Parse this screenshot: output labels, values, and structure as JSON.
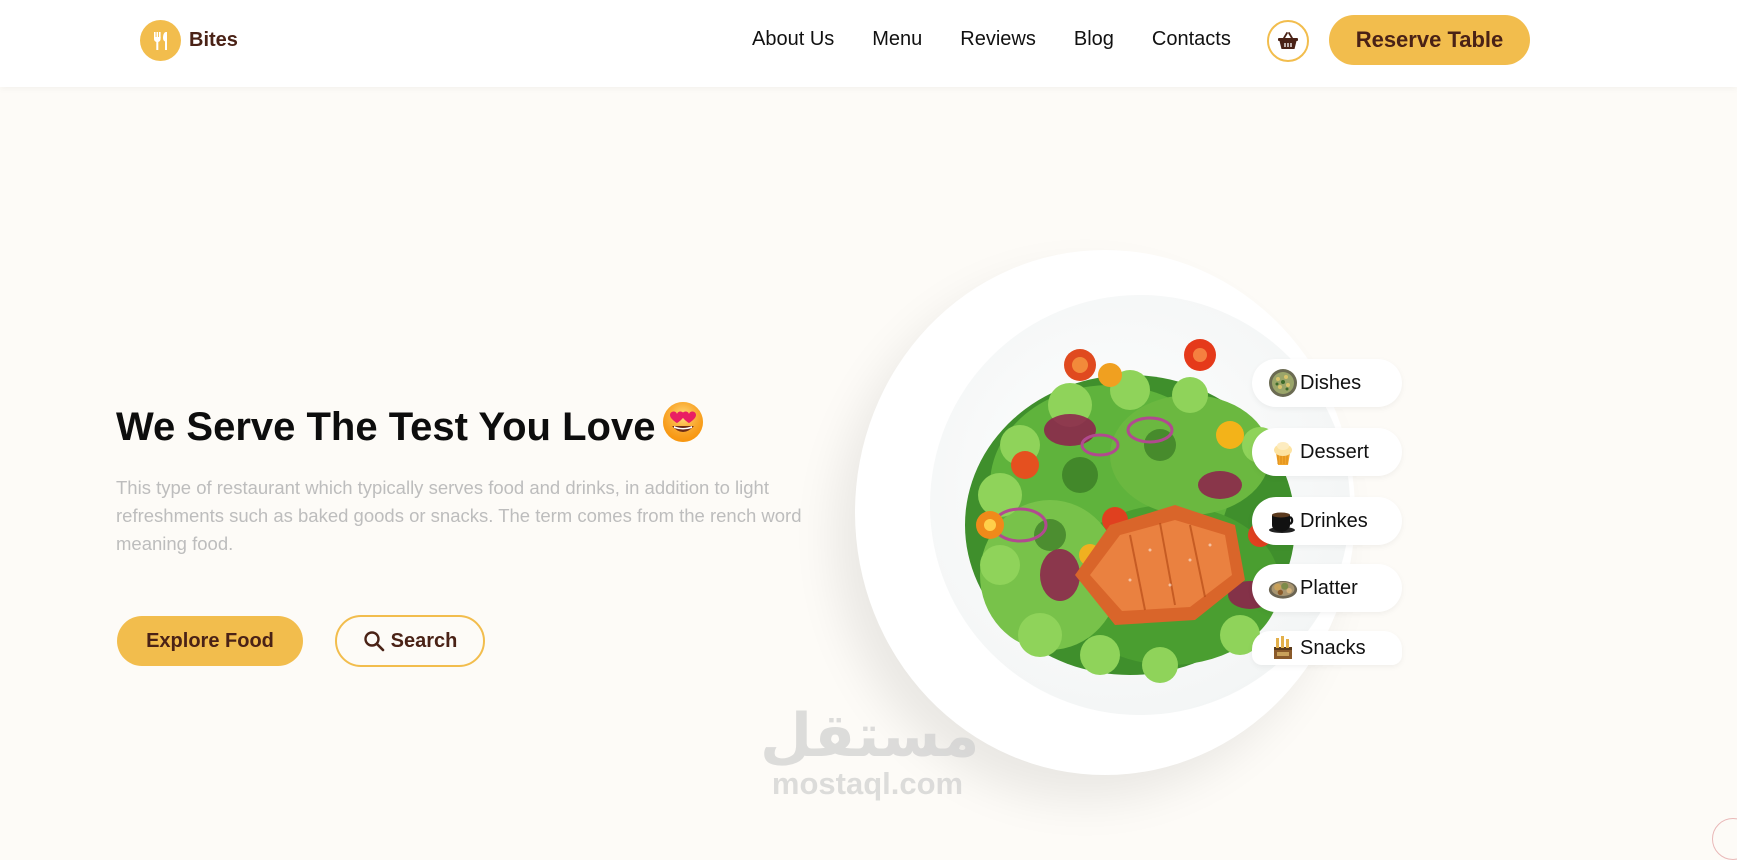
{
  "header": {
    "logo_text": "Bites",
    "nav": [
      "About Us",
      "Menu",
      "Reviews",
      "Blog",
      "Contacts"
    ],
    "reserve_label": "Reserve Table",
    "cart_icon": "basket-icon"
  },
  "hero": {
    "title": "We Serve The Test You Love",
    "title_emoji": "heart-eyes-emoji",
    "description": "This type of restaurant which typically serves food and drinks, in addition to light refreshments such as baked goods or snacks. The term comes from the rench word meaning food.",
    "explore_label": "Explore Food",
    "search_label": "Search"
  },
  "categories": [
    {
      "label": "Dishes",
      "icon": "dish-bowl-icon"
    },
    {
      "label": "Dessert",
      "icon": "cupcake-icon"
    },
    {
      "label": "Drinkes",
      "icon": "coffee-cup-icon"
    },
    {
      "label": "Platter",
      "icon": "platter-icon"
    },
    {
      "label": "Snacks",
      "icon": "snacks-bag-icon"
    }
  ],
  "watermark": {
    "arabic": "مستقل",
    "latin": "mostaql.com"
  },
  "colors": {
    "accent": "#f2bd4d",
    "brand_dark": "#4a2216",
    "background": "#fdfbf7",
    "muted_text": "#bdbdbd"
  }
}
